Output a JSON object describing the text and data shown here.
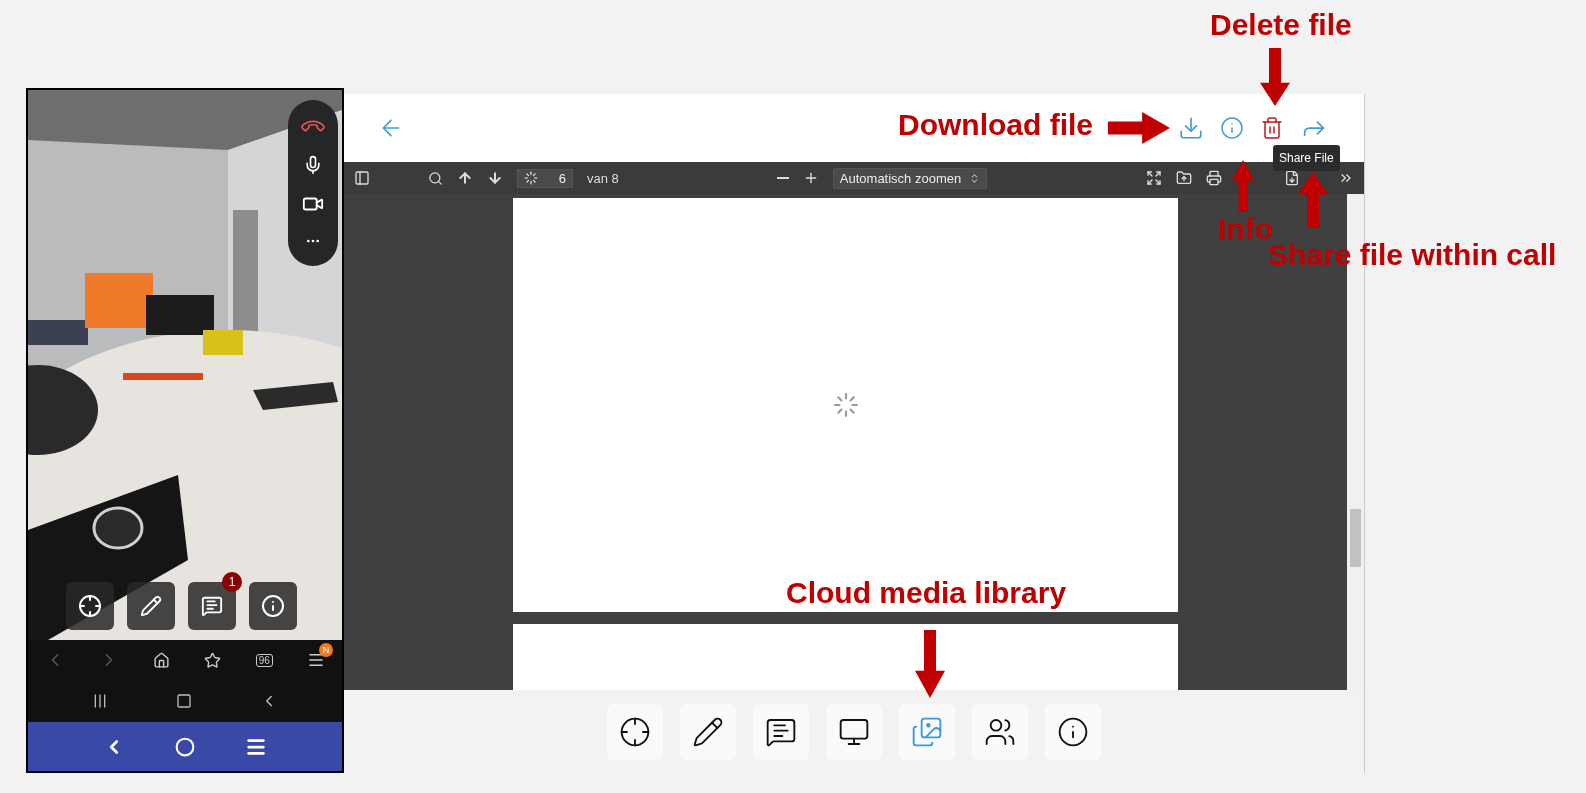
{
  "phone": {
    "chat_badge": "1",
    "tabs_count": "96",
    "menu_badge": "N"
  },
  "viewer": {
    "page": "6",
    "page_total": "van 8",
    "zoom": "Automatisch zoomen"
  },
  "tooltip": "Share File",
  "bottom_toolbar": [
    {
      "kind": "target",
      "selected": false
    },
    {
      "kind": "pencil",
      "selected": false
    },
    {
      "kind": "chat",
      "selected": false
    },
    {
      "kind": "screen",
      "selected": false
    },
    {
      "kind": "media",
      "selected": true
    },
    {
      "kind": "users",
      "selected": false
    },
    {
      "kind": "info",
      "selected": false
    }
  ],
  "annotations": [
    {
      "kind": "download",
      "text": "Download file"
    },
    {
      "kind": "delete",
      "text": "Delete file"
    },
    {
      "kind": "info",
      "text": "Info"
    },
    {
      "kind": "share",
      "text": "Share file within call"
    },
    {
      "kind": "media",
      "text": "Cloud media library"
    }
  ]
}
